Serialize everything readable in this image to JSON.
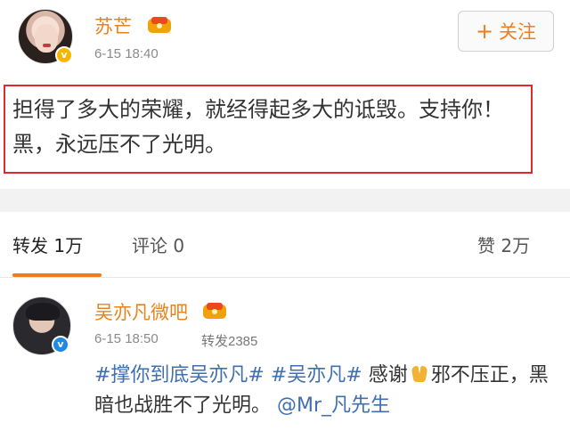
{
  "post": {
    "author": "苏芒",
    "time": "6-15 18:40",
    "follow_label": "关注",
    "follow_icon": "+",
    "text": "担得了多大的荣耀，就经得起多大的诋毁。支持你！黑，永远压不了光明。",
    "badge": "v",
    "highlight_color": "#e02a2a"
  },
  "tabs": {
    "repost": "转发 1万",
    "comment": "评论 0",
    "like": "赞 2万"
  },
  "repost": {
    "author": "吴亦凡微吧",
    "time": "6-15 18:50",
    "repost_count": "转发2385",
    "badge": "v",
    "tag1": "#撑你到底吴亦凡#",
    "tag2": "#吴亦凡#",
    "text_a": "感谢",
    "text_b": "邪不压正，黑暗也战胜不了光明。",
    "mention": "@Mr_凡先生"
  },
  "colors": {
    "username": "#e8831b",
    "accent": "#f27a1a",
    "link": "#3f6fb0"
  }
}
